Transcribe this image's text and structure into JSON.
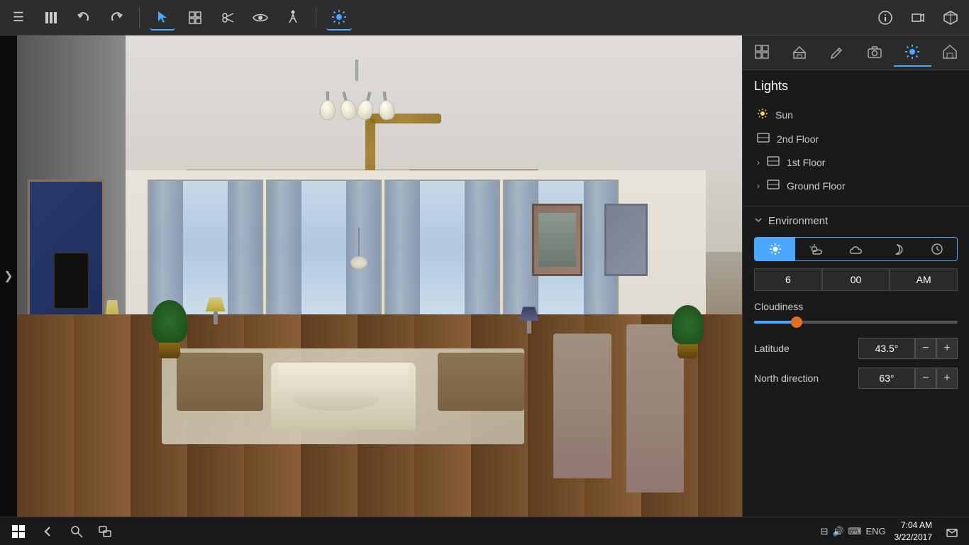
{
  "toolbar": {
    "icons": [
      {
        "name": "hamburger-menu-icon",
        "symbol": "☰",
        "active": false
      },
      {
        "name": "library-icon",
        "symbol": "📚",
        "active": false
      },
      {
        "name": "undo-icon",
        "symbol": "↩",
        "active": false
      },
      {
        "name": "redo-icon",
        "symbol": "↪",
        "active": false
      },
      {
        "name": "select-icon",
        "symbol": "⬆",
        "active": true
      },
      {
        "name": "group-icon",
        "symbol": "⊞",
        "active": false
      },
      {
        "name": "scissors-icon",
        "symbol": "✂",
        "active": false
      },
      {
        "name": "eye-icon",
        "symbol": "👁",
        "active": false
      },
      {
        "name": "walk-icon",
        "symbol": "🚶",
        "active": false
      },
      {
        "name": "sun-toolbar-icon",
        "symbol": "☀",
        "active": true
      },
      {
        "name": "info-icon",
        "symbol": "ℹ",
        "active": false
      },
      {
        "name": "frame-icon",
        "symbol": "⬜",
        "active": false
      },
      {
        "name": "box-icon",
        "symbol": "📦",
        "active": false
      }
    ]
  },
  "right_panel": {
    "icons": [
      {
        "name": "panel-items-icon",
        "symbol": "🛒",
        "active": false
      },
      {
        "name": "panel-build-icon",
        "symbol": "🏗",
        "active": false
      },
      {
        "name": "panel-edit-icon",
        "symbol": "✏️",
        "active": false
      },
      {
        "name": "panel-camera-icon",
        "symbol": "📷",
        "active": false
      },
      {
        "name": "panel-lights-icon",
        "symbol": "☀",
        "active": true
      },
      {
        "name": "panel-house-icon",
        "symbol": "🏠",
        "active": false
      }
    ]
  },
  "lights": {
    "title": "Lights",
    "items": [
      {
        "label": "Sun",
        "icon": "sun",
        "expandable": false
      },
      {
        "label": "2nd Floor",
        "icon": "floor",
        "expandable": false
      },
      {
        "label": "1st Floor",
        "icon": "floor",
        "expandable": true
      },
      {
        "label": "Ground Floor",
        "icon": "floor",
        "expandable": true
      }
    ]
  },
  "environment": {
    "title": "Environment",
    "time_buttons": [
      {
        "label": "☀",
        "name": "clear-day-btn",
        "active": true
      },
      {
        "label": "🌤",
        "name": "partly-cloudy-btn",
        "active": false
      },
      {
        "label": "☁",
        "name": "cloudy-btn",
        "active": false
      },
      {
        "label": "🌙",
        "name": "night-btn",
        "active": false
      },
      {
        "label": "🕐",
        "name": "custom-time-btn",
        "active": false
      }
    ],
    "time_hour": "6",
    "time_minute": "00",
    "time_ampm": "AM",
    "cloudiness_label": "Cloudiness",
    "cloudiness_value": 20,
    "latitude_label": "Latitude",
    "latitude_value": "43.5°",
    "north_direction_label": "North direction",
    "north_direction_value": "63°"
  },
  "taskbar": {
    "time": "7:04 AM",
    "date": "3/22/2017"
  },
  "left_nav": {
    "arrow": "❯"
  }
}
